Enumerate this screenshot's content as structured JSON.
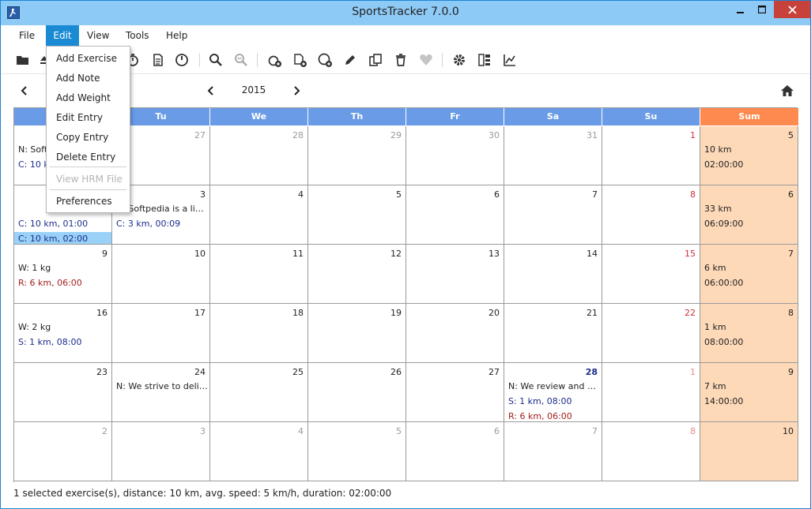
{
  "window": {
    "title": "SportsTracker 7.0.0"
  },
  "menubar": {
    "items": [
      "File",
      "Edit",
      "View",
      "Tools",
      "Help"
    ],
    "active": "Edit"
  },
  "edit_menu": {
    "items": [
      {
        "label": "Add Exercise",
        "enabled": true
      },
      {
        "label": "Add Note",
        "enabled": true
      },
      {
        "label": "Add Weight",
        "enabled": true
      },
      {
        "label": "Edit Entry",
        "enabled": true
      },
      {
        "label": "Copy Entry",
        "enabled": true
      },
      {
        "label": "Delete Entry",
        "enabled": true
      },
      {
        "label": "View HRM File",
        "enabled": false
      },
      {
        "label": "Preferences",
        "enabled": true
      }
    ]
  },
  "toolbar": {
    "icons": [
      "open-folder-icon",
      "eject-icon",
      "stopwatch-icon",
      "document-icon",
      "speedometer-icon",
      "zoom-in-icon",
      "zoom-out-icon",
      "add-exercise-icon",
      "add-note-icon",
      "add-weight-icon",
      "edit-icon",
      "copy-icon",
      "delete-icon",
      "heart-icon",
      "settings-icon",
      "overview-icon",
      "statistics-icon"
    ]
  },
  "navigation": {
    "year": "2015"
  },
  "calendar": {
    "headers": [
      "Mo",
      "Tu",
      "We",
      "Th",
      "Fr",
      "Sa",
      "Su",
      "Sum"
    ],
    "weeks": [
      {
        "days": [
          {
            "date": "",
            "style": "normal",
            "entries": [
              {
                "text": "N: Softpedia is a library",
                "kind": "note"
              },
              {
                "text": "C: 10 km, 01:00",
                "kind": "cycling"
              }
            ]
          },
          {
            "date": "27",
            "style": "other",
            "entries": []
          },
          {
            "date": "28",
            "style": "other",
            "entries": []
          },
          {
            "date": "29",
            "style": "other",
            "entries": []
          },
          {
            "date": "30",
            "style": "other",
            "entries": []
          },
          {
            "date": "31",
            "style": "other",
            "entries": []
          },
          {
            "date": "1",
            "style": "sunday",
            "entries": []
          }
        ],
        "sum": {
          "week": "5",
          "lines": [
            "10 km",
            "02:00:00"
          ]
        }
      },
      {
        "days": [
          {
            "date": "",
            "style": "normal",
            "entries": [
              {
                "text": "",
                "kind": "blank"
              },
              {
                "text": "C: 10 km, 01:00",
                "kind": "cycling"
              },
              {
                "text": "C: 10 km, 02:00",
                "kind": "cycling",
                "selected": true
              },
              {
                "text": "C: 10 km, 02:00",
                "kind": "cycling"
              }
            ]
          },
          {
            "date": "3",
            "style": "normal",
            "entries": [
              {
                "text": "N: Softpedia is a library of software",
                "kind": "note"
              },
              {
                "text": "C: 3 km, 00:09",
                "kind": "cycling"
              }
            ]
          },
          {
            "date": "4",
            "style": "normal",
            "entries": []
          },
          {
            "date": "5",
            "style": "normal",
            "entries": []
          },
          {
            "date": "6",
            "style": "normal",
            "entries": []
          },
          {
            "date": "7",
            "style": "normal",
            "entries": []
          },
          {
            "date": "8",
            "style": "sunday",
            "entries": []
          }
        ],
        "sum": {
          "week": "6",
          "lines": [
            "33 km",
            "06:09:00"
          ]
        }
      },
      {
        "days": [
          {
            "date": "9",
            "style": "normal",
            "entries": [
              {
                "text": "W: 1 kg",
                "kind": "weight"
              },
              {
                "text": "R: 6 km, 06:00",
                "kind": "running"
              }
            ]
          },
          {
            "date": "10",
            "style": "normal",
            "entries": []
          },
          {
            "date": "11",
            "style": "normal",
            "entries": []
          },
          {
            "date": "12",
            "style": "normal",
            "entries": []
          },
          {
            "date": "13",
            "style": "normal",
            "entries": []
          },
          {
            "date": "14",
            "style": "normal",
            "entries": []
          },
          {
            "date": "15",
            "style": "sunday",
            "entries": []
          }
        ],
        "sum": {
          "week": "7",
          "lines": [
            "6 km",
            "06:00:00"
          ]
        }
      },
      {
        "days": [
          {
            "date": "16",
            "style": "normal",
            "entries": [
              {
                "text": "W: 2 kg",
                "kind": "weight"
              },
              {
                "text": "S: 1 km, 08:00",
                "kind": "swimming"
              }
            ]
          },
          {
            "date": "17",
            "style": "normal",
            "entries": []
          },
          {
            "date": "18",
            "style": "normal",
            "entries": []
          },
          {
            "date": "19",
            "style": "normal",
            "entries": []
          },
          {
            "date": "20",
            "style": "normal",
            "entries": []
          },
          {
            "date": "21",
            "style": "normal",
            "entries": []
          },
          {
            "date": "22",
            "style": "sunday",
            "entries": []
          }
        ],
        "sum": {
          "week": "8",
          "lines": [
            "1 km",
            "08:00:00"
          ]
        }
      },
      {
        "days": [
          {
            "date": "23",
            "style": "normal",
            "entries": []
          },
          {
            "date": "24",
            "style": "normal",
            "entries": [
              {
                "text": "N: We strive to deliver the best",
                "kind": "note"
              }
            ]
          },
          {
            "date": "25",
            "style": "normal",
            "entries": []
          },
          {
            "date": "26",
            "style": "normal",
            "entries": []
          },
          {
            "date": "27",
            "style": "normal",
            "entries": []
          },
          {
            "date": "28",
            "style": "today",
            "entries": [
              {
                "text": "N: We review and categorize",
                "kind": "note"
              },
              {
                "text": "S: 1 km, 08:00",
                "kind": "swimming"
              },
              {
                "text": "R: 6 km, 06:00",
                "kind": "running"
              }
            ]
          },
          {
            "date": "1",
            "style": "sunday-other",
            "entries": []
          }
        ],
        "sum": {
          "week": "9",
          "lines": [
            "7 km",
            "14:00:00"
          ]
        }
      },
      {
        "days": [
          {
            "date": "2",
            "style": "other",
            "entries": []
          },
          {
            "date": "3",
            "style": "other",
            "entries": []
          },
          {
            "date": "4",
            "style": "other",
            "entries": []
          },
          {
            "date": "5",
            "style": "other",
            "entries": []
          },
          {
            "date": "6",
            "style": "other",
            "entries": []
          },
          {
            "date": "7",
            "style": "other",
            "entries": []
          },
          {
            "date": "8",
            "style": "sunday-other",
            "entries": []
          }
        ],
        "sum": {
          "week": "10",
          "lines": []
        }
      }
    ]
  },
  "statusbar": {
    "text": "1 selected exercise(s), distance: 10 km, avg. speed: 5 km/h, duration: 02:00:00"
  },
  "colors": {
    "titlebar": "#8ecaf6",
    "header_blue": "#6a9be6",
    "header_sum": "#ff8a50",
    "sum_cell": "#fdd9b8",
    "selected": "#99d1f7",
    "menu_active": "#1a8ad4"
  }
}
